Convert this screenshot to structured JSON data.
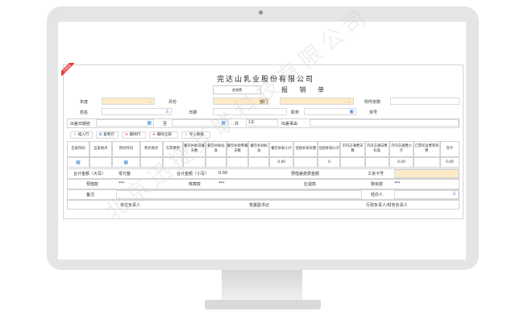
{
  "corner_tag": "已审核",
  "title": "完达山乳业股份有限公司",
  "subtitle": "报 销 单",
  "type_select": "差旅费",
  "labels": {
    "year": "年度",
    "month": "月份",
    "dept": "部门",
    "attachments": "附件张数",
    "name": "姓名",
    "date": "日期",
    "position": "职务",
    "no": "单号",
    "trip_start": "出差日期自",
    "to": "至",
    "total": "共",
    "reason": "出差事由",
    "total_upper": "合计金额（大写）",
    "total_lower": "合计金额（小写）",
    "prepaid_total": "预借差旅费金额",
    "advance": "预借款",
    "reimbursed": "核算款",
    "return": "应退款",
    "remark": "备注",
    "handler": "经办人",
    "job_no": "工资卡号",
    "remaining": "剩余款"
  },
  "values": {
    "days": "1天",
    "total_upper_value": "零元整",
    "total_lower_value": "0.00",
    "advance_value": "***",
    "reimbursed_value": "***",
    "remaining_value": "***"
  },
  "buttons": [
    "插入行",
    "复制行",
    "删除行",
    "删除全部",
    "导入数据"
  ],
  "columns": [
    "出发时间",
    "出发地点",
    "到达时间",
    "到达地点",
    "车票费用",
    "餐饮补助日餐天数",
    "餐饮补助标准",
    "餐饮补助零餐天数",
    "餐饮补助标准",
    "餐饮补助小计",
    "住宿补助天数",
    "住宿补助小计",
    "市内交通费天数",
    "市内交通日费标准",
    "市内交通费小计",
    "订票托运费等杂费",
    "合计"
  ],
  "row_values": [
    "0.00",
    "0",
    "0.00",
    "0.00"
  ],
  "footer": [
    "单位负责人",
    "党委副书记",
    "行政负责人/财务负责人"
  ],
  "watermark": "北京迅捷互联科技有限公司",
  "colors": {
    "accent": "#e5393a",
    "highlight": "#fdebc8",
    "icon": "#4a90e2"
  }
}
